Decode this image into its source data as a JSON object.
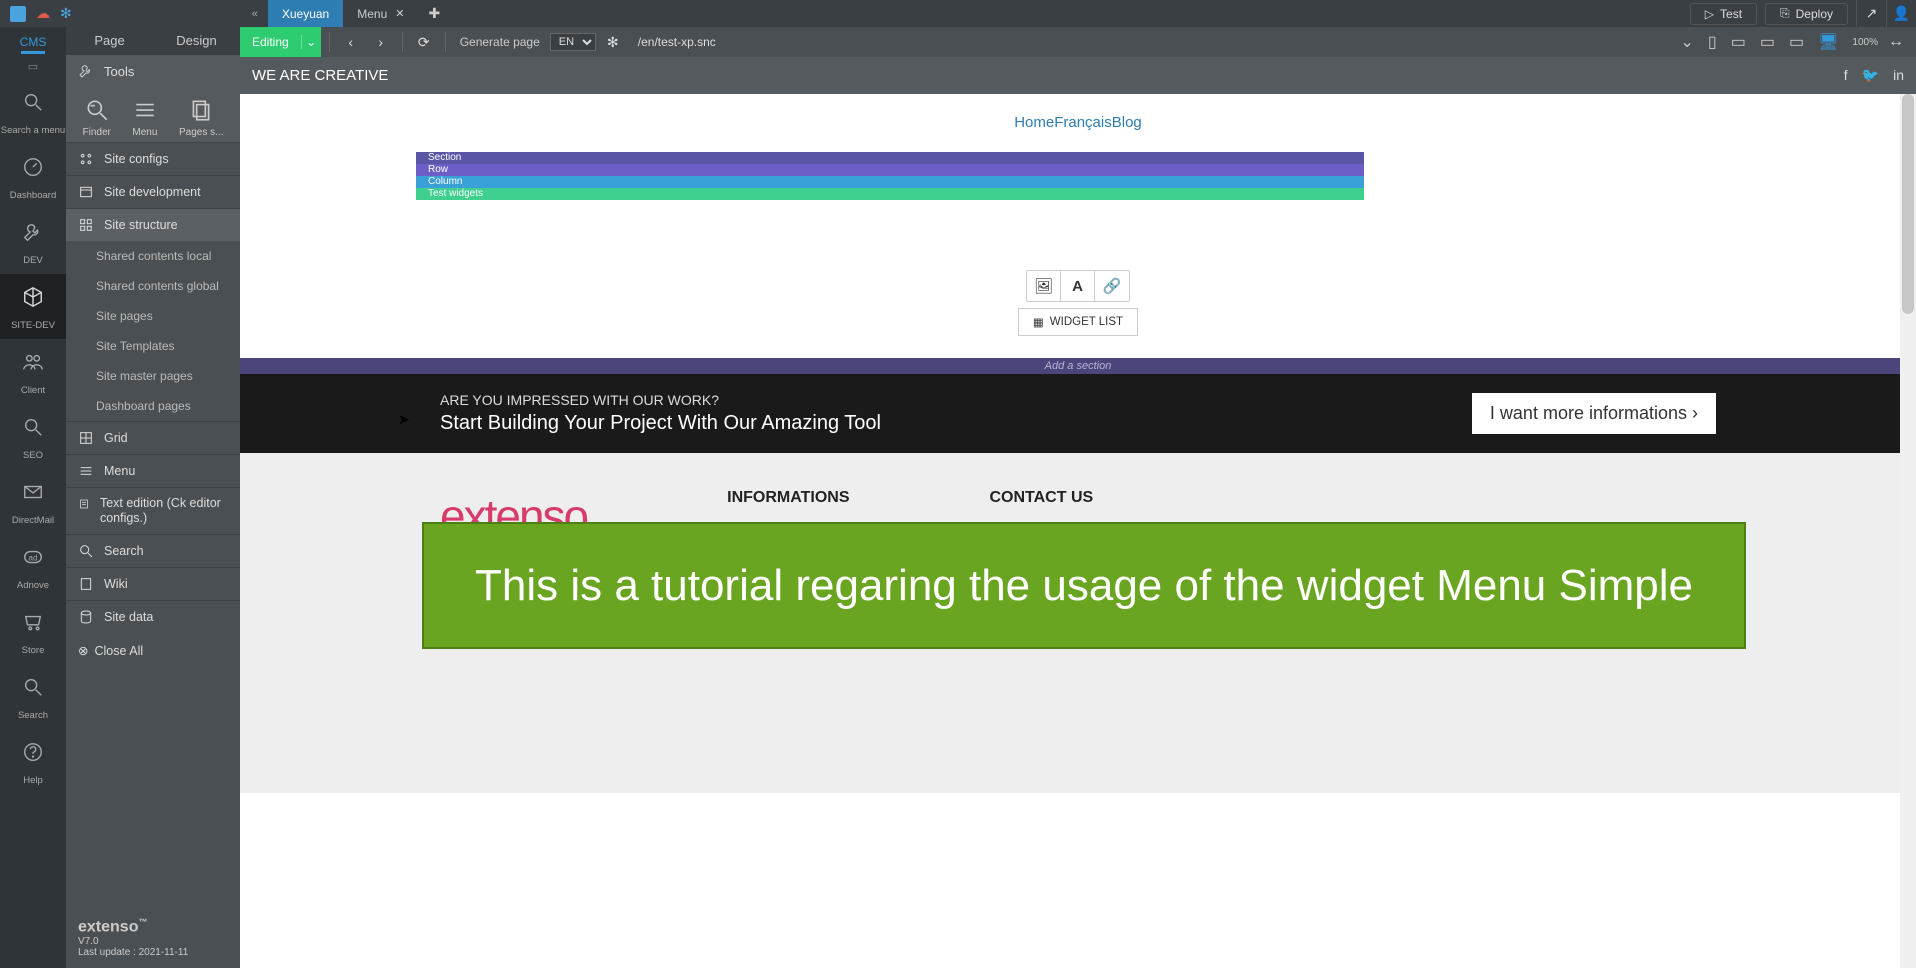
{
  "titlebar": {
    "tabs": [
      {
        "label": "Xueyuan",
        "active": true
      },
      {
        "label": "Menu",
        "active": false
      }
    ],
    "test_label": "Test",
    "deploy_label": "Deploy"
  },
  "icon_sidebar": {
    "cms": "CMS",
    "items": [
      {
        "label": "Search a menu"
      },
      {
        "label": "Dashboard"
      },
      {
        "label": "DEV"
      },
      {
        "label": "SITE-DEV"
      },
      {
        "label": "Client"
      },
      {
        "label": "SEO"
      },
      {
        "label": "DirectMail"
      },
      {
        "label": "Adnove"
      },
      {
        "label": "Store"
      },
      {
        "label": "Search"
      },
      {
        "label": "Help"
      }
    ]
  },
  "tools_panel": {
    "mode_tabs": [
      "Page",
      "Design"
    ],
    "header": "Tools",
    "tool_icons": [
      {
        "label": "Finder"
      },
      {
        "label": "Menu"
      },
      {
        "label": "Pages s..."
      }
    ],
    "tree": {
      "site_configs": "Site configs",
      "site_development": "Site development",
      "site_structure": "Site structure",
      "structure_children": [
        "Shared contents local",
        "Shared contents global",
        "Site pages",
        "Site Templates",
        "Site master pages",
        "Dashboard pages"
      ],
      "grid": "Grid",
      "menu": "Menu",
      "text_edition": "Text edition (Ck editor configs.)",
      "search": "Search",
      "wiki": "Wiki",
      "site_data": "Site data"
    },
    "close_all": "Close All",
    "brand": {
      "name": "extenso",
      "tm": "™",
      "version": "V7.0",
      "last_update": "Last update : 2021-11-11"
    }
  },
  "edit_toolbar": {
    "editing": "Editing",
    "generate": "Generate page",
    "lang": "EN",
    "url": "/en/test-xp.snc",
    "zoom": "100%"
  },
  "hero": {
    "title": "WE ARE CREATIVE"
  },
  "preview": {
    "nav": {
      "home": "Home",
      "fr": "Français",
      "blog": "Blog"
    },
    "bands": {
      "section": "Section",
      "row": "Row",
      "column": "Column",
      "widgets": "Test widgets"
    },
    "widget_list": "WIDGET LIST",
    "add_section": "Add a section",
    "cta": {
      "line1": "ARE YOU IMPRESSED WITH OUR WORK?",
      "line2": "Start Building Your Project With Our Amazing Tool",
      "button": "I want more informations ›"
    },
    "footer": {
      "logo": "extenso",
      "info_heading": "INFORMATIONS",
      "contact_heading": "CONTACT US"
    },
    "tutorial": "This is a tutorial regaring the usage of the widget Menu Simple"
  }
}
